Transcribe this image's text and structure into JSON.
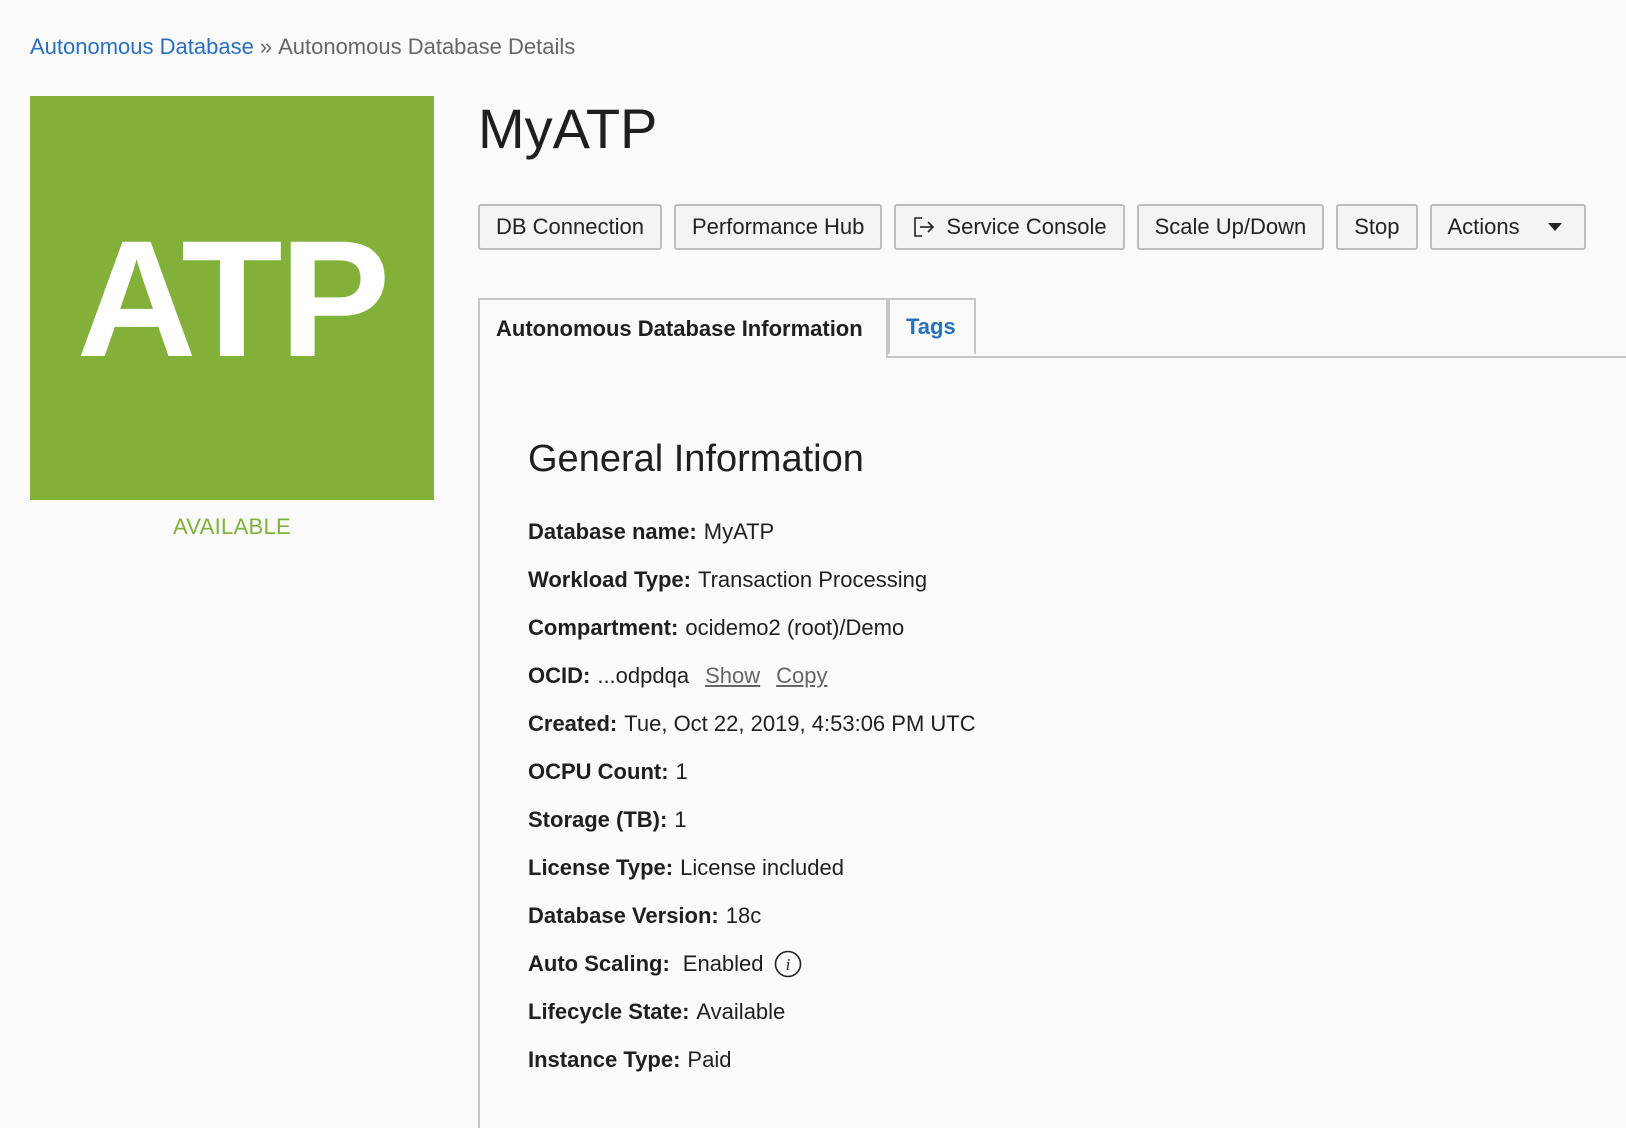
{
  "breadcrumb": {
    "parent": "Autonomous Database",
    "separator": "»",
    "current": "Autonomous Database Details"
  },
  "logo": {
    "text": "ATP",
    "color": "#82b13a"
  },
  "status": {
    "text": "AVAILABLE",
    "color": "#82b13a"
  },
  "title": "MyATP",
  "toolbar": {
    "db_connection": "DB Connection",
    "performance_hub": "Performance Hub",
    "service_console": "Service Console",
    "service_console_icon": "external-link-icon",
    "scale": "Scale Up/Down",
    "stop": "Stop",
    "actions": "Actions",
    "actions_icon": "chevron-down-icon"
  },
  "tabs": [
    {
      "label": "Autonomous Database Information",
      "active": true
    },
    {
      "label": "Tags",
      "active": false
    }
  ],
  "general_info": {
    "heading": "General Information",
    "rows": {
      "database_name": {
        "label": "Database name:",
        "value": "MyATP"
      },
      "workload_type": {
        "label": "Workload Type:",
        "value": "Transaction Processing"
      },
      "compartment": {
        "label": "Compartment:",
        "value": "ocidemo2 (root)/Demo"
      },
      "ocid": {
        "label": "OCID:",
        "value": "...odpdqa",
        "show": "Show",
        "copy": "Copy"
      },
      "created": {
        "label": "Created:",
        "value": "Tue, Oct 22, 2019, 4:53:06 PM UTC"
      },
      "ocpu_count": {
        "label": "OCPU Count:",
        "value": "1"
      },
      "storage": {
        "label": "Storage (TB):",
        "value": "1"
      },
      "license_type": {
        "label": "License Type:",
        "value": "License included"
      },
      "db_version": {
        "label": "Database Version:",
        "value": "18c"
      },
      "auto_scaling": {
        "label": "Auto Scaling:",
        "value": "Enabled",
        "icon": "info-icon"
      },
      "lifecycle_state": {
        "label": "Lifecycle State:",
        "value": "Available"
      },
      "instance_type": {
        "label": "Instance Type:",
        "value": "Paid"
      }
    }
  },
  "colors": {
    "link": "#2a6fbe",
    "accent_green": "#82b13a"
  }
}
